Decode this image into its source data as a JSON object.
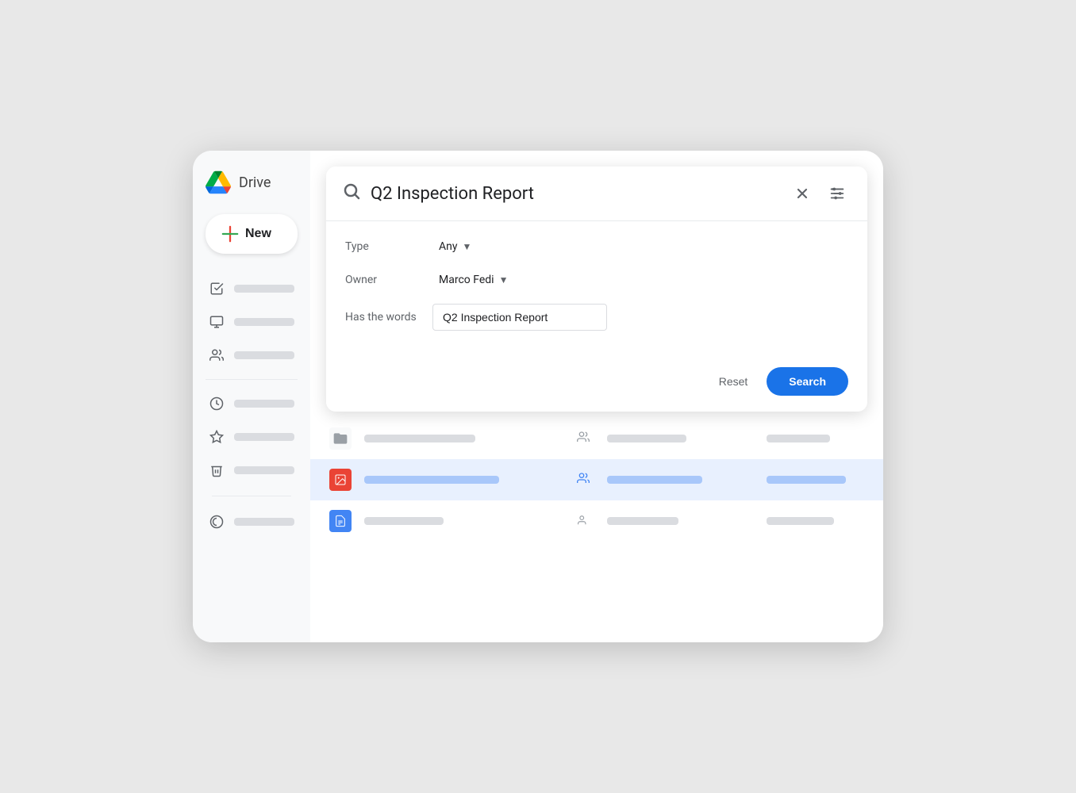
{
  "app": {
    "title": "Drive"
  },
  "sidebar": {
    "new_button_label": "New",
    "items": [
      {
        "id": "my-drive",
        "icon": "☑",
        "label": ""
      },
      {
        "id": "computers",
        "icon": "🖼",
        "label": ""
      },
      {
        "id": "shared",
        "icon": "👥",
        "label": ""
      },
      {
        "id": "recent",
        "icon": "🕐",
        "label": ""
      },
      {
        "id": "starred",
        "icon": "☆",
        "label": ""
      },
      {
        "id": "trash",
        "icon": "🗑",
        "label": ""
      },
      {
        "id": "storage",
        "icon": "☁",
        "label": ""
      }
    ]
  },
  "search_dialog": {
    "query": "Q2 Inspection Report",
    "close_label": "×",
    "filters_icon": "≡",
    "type_label": "Type",
    "type_value": "Any",
    "owner_label": "Owner",
    "owner_value": "Marco Fedi",
    "has_words_label": "Has the words",
    "has_words_value": "Q2 Inspection Report",
    "reset_label": "Reset",
    "search_label": "Search"
  },
  "file_list": {
    "rows": [
      {
        "id": "row1",
        "type": "folder",
        "highlighted": false
      },
      {
        "id": "row2",
        "type": "image",
        "highlighted": true
      },
      {
        "id": "row3",
        "type": "doc",
        "highlighted": false
      }
    ]
  }
}
